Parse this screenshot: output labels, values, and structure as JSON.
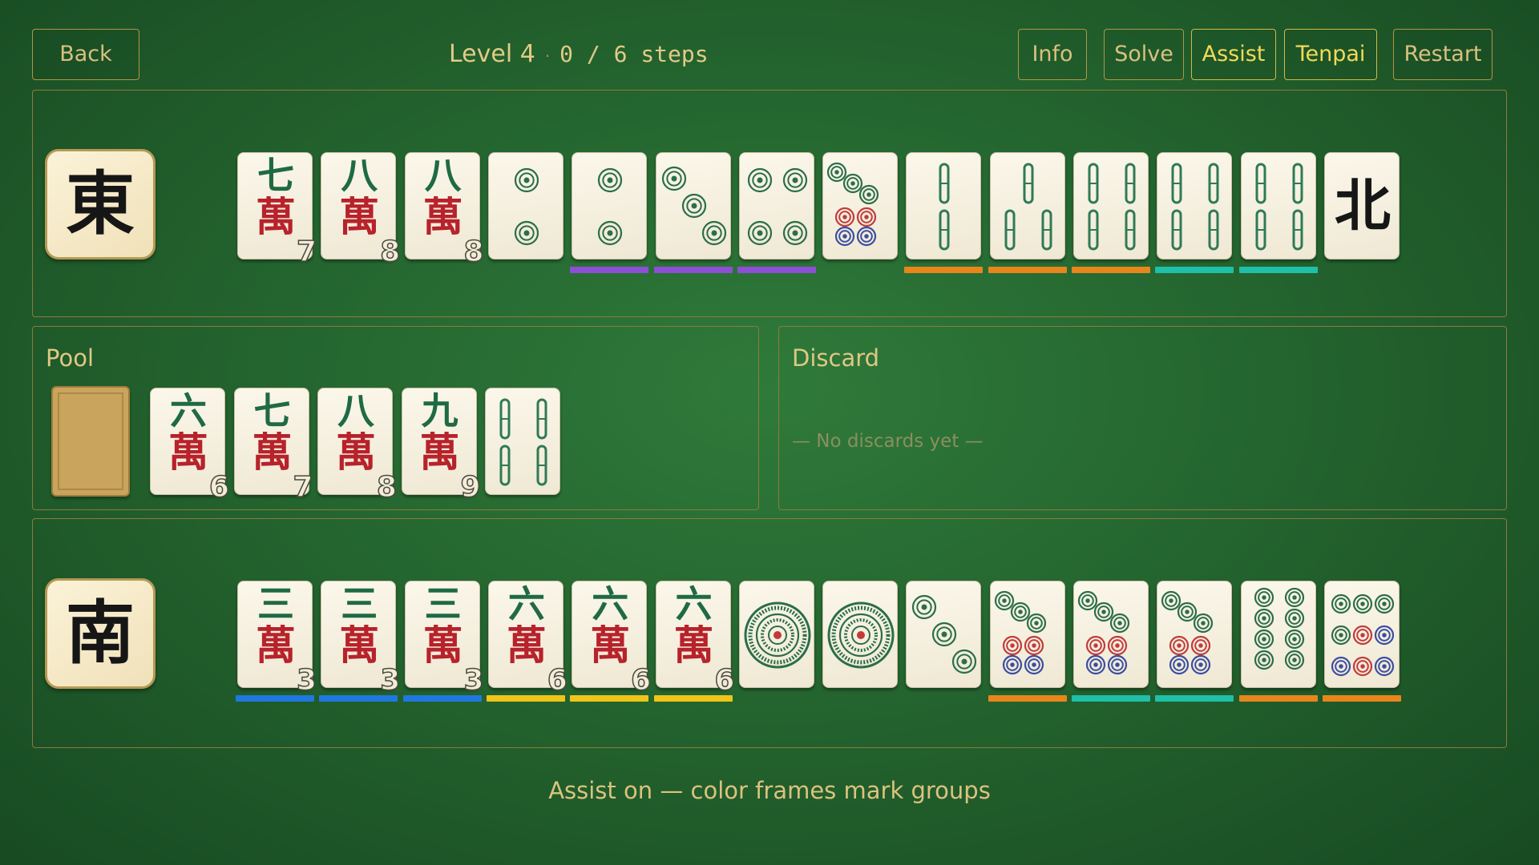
{
  "toolbar": {
    "back_label": "Back",
    "info_label": "Info",
    "solve_label": "Solve",
    "assist_label": "Assist",
    "tenpai_label": "Tenpai",
    "restart_label": "Restart"
  },
  "header": {
    "level_label": "Level 4",
    "separator": "·",
    "steps_text": "0 / 6 steps"
  },
  "pool": {
    "title": "Pool",
    "tiles": [
      {
        "id": "6m",
        "suit": "man",
        "rank": 6,
        "kanji": "六",
        "wan": "萬",
        "badge": "6"
      },
      {
        "id": "7m",
        "suit": "man",
        "rank": 7,
        "kanji": "七",
        "wan": "萬",
        "badge": "7"
      },
      {
        "id": "8m",
        "suit": "man",
        "rank": 8,
        "kanji": "八",
        "wan": "萬",
        "badge": "8"
      },
      {
        "id": "9m",
        "suit": "man",
        "rank": 9,
        "kanji": "九",
        "wan": "萬",
        "badge": "9"
      },
      {
        "id": "4s",
        "suit": "sou",
        "rank": 4
      }
    ]
  },
  "discard": {
    "title": "Discard",
    "empty_text": "— No discards yet —"
  },
  "colors": {
    "purple": "#8d4fd6",
    "orange": "#e8861c",
    "teal": "#1fbfa9",
    "blue": "#1f78e0",
    "yellow": "#f0c419",
    "bamboo": "#2f7a57",
    "circle_green": "#2b6e4a",
    "circle_red": "#c23b3b",
    "circle_blue": "#3b4ea0"
  },
  "players": [
    {
      "seat_label": "東",
      "seat_icon": "east-wind-icon",
      "tiles": [
        {
          "id": "7m",
          "suit": "man",
          "rank": 7,
          "kanji": "七",
          "wan": "萬",
          "badge": "7",
          "group": null
        },
        {
          "id": "8m",
          "suit": "man",
          "rank": 8,
          "kanji": "八",
          "wan": "萬",
          "badge": "8",
          "group": null
        },
        {
          "id": "8m",
          "suit": "man",
          "rank": 8,
          "kanji": "八",
          "wan": "萬",
          "badge": "8",
          "group": null
        },
        {
          "id": "2p",
          "suit": "pin",
          "rank": 2,
          "group": null
        },
        {
          "id": "2p",
          "suit": "pin",
          "rank": 2,
          "group": "purple"
        },
        {
          "id": "3p",
          "suit": "pin",
          "rank": 3,
          "group": "purple"
        },
        {
          "id": "4p",
          "suit": "pin",
          "rank": 4,
          "group": "purple"
        },
        {
          "id": "7p",
          "suit": "pin",
          "rank": 7,
          "group": null
        },
        {
          "id": "2s",
          "suit": "sou",
          "rank": 2,
          "group": "orange"
        },
        {
          "id": "3s",
          "suit": "sou",
          "rank": 3,
          "group": "orange"
        },
        {
          "id": "4s",
          "suit": "sou",
          "rank": 4,
          "group": "orange"
        },
        {
          "id": "4s",
          "suit": "sou",
          "rank": 4,
          "group": "teal"
        },
        {
          "id": "4s",
          "suit": "sou",
          "rank": 4,
          "group": "teal"
        },
        {
          "id": "N",
          "suit": "wind",
          "kanji": "北",
          "group": null
        }
      ]
    },
    {
      "seat_label": "南",
      "seat_icon": "south-wind-icon",
      "tiles": [
        {
          "id": "3m",
          "suit": "man",
          "rank": 3,
          "kanji": "三",
          "wan": "萬",
          "badge": "3",
          "group": "blue"
        },
        {
          "id": "3m",
          "suit": "man",
          "rank": 3,
          "kanji": "三",
          "wan": "萬",
          "badge": "3",
          "group": "blue"
        },
        {
          "id": "3m",
          "suit": "man",
          "rank": 3,
          "kanji": "三",
          "wan": "萬",
          "badge": "3",
          "group": "blue"
        },
        {
          "id": "6m",
          "suit": "man",
          "rank": 6,
          "kanji": "六",
          "wan": "萬",
          "badge": "6",
          "group": "yellow"
        },
        {
          "id": "6m",
          "suit": "man",
          "rank": 6,
          "kanji": "六",
          "wan": "萬",
          "badge": "6",
          "group": "yellow"
        },
        {
          "id": "6m",
          "suit": "man",
          "rank": 6,
          "kanji": "六",
          "wan": "萬",
          "badge": "6",
          "group": "yellow"
        },
        {
          "id": "1p",
          "suit": "pin",
          "rank": 1,
          "group": null
        },
        {
          "id": "1p",
          "suit": "pin",
          "rank": 1,
          "group": null
        },
        {
          "id": "3p",
          "suit": "pin",
          "rank": 3,
          "group": null
        },
        {
          "id": "7p",
          "suit": "pin",
          "rank": 7,
          "group": "orange"
        },
        {
          "id": "7p",
          "suit": "pin",
          "rank": 7,
          "group": "teal"
        },
        {
          "id": "7p",
          "suit": "pin",
          "rank": 7,
          "group": "teal"
        },
        {
          "id": "8p",
          "suit": "pin",
          "rank": 8,
          "group": "orange"
        },
        {
          "id": "9p",
          "suit": "pin",
          "rank": 9,
          "group": "orange"
        }
      ]
    }
  ],
  "status_text": "Assist on — color frames mark groups"
}
